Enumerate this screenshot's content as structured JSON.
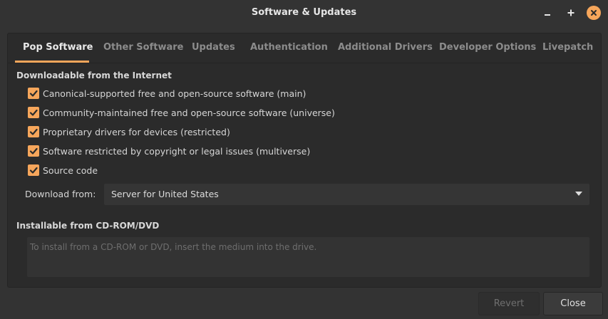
{
  "window": {
    "title": "Software & Updates"
  },
  "tabs": [
    {
      "label": "Pop Software"
    },
    {
      "label": "Other Software"
    },
    {
      "label": "Updates"
    },
    {
      "label": "Authentication"
    },
    {
      "label": "Additional Drivers"
    },
    {
      "label": "Developer Options"
    },
    {
      "label": "Livepatch"
    }
  ],
  "download_section": {
    "title": "Downloadable from the Internet",
    "options": [
      {
        "label": "Canonical-supported free and open-source software (main)",
        "checked": true
      },
      {
        "label": "Community-maintained free and open-source software (universe)",
        "checked": true
      },
      {
        "label": "Proprietary drivers for devices (restricted)",
        "checked": true
      },
      {
        "label": "Software restricted by copyright or legal issues (multiverse)",
        "checked": true
      },
      {
        "label": "Source code",
        "checked": true
      }
    ],
    "download_from_label": "Download from:",
    "download_from_value": "Server for United States"
  },
  "cdrom_section": {
    "title": "Installable from CD-ROM/DVD",
    "hint": "To install from a CD-ROM or DVD, insert the medium into the drive."
  },
  "buttons": {
    "revert": "Revert",
    "close": "Close"
  },
  "colors": {
    "accent": "#f6a65b",
    "background": "#333333",
    "panel": "#2b2b2b"
  }
}
